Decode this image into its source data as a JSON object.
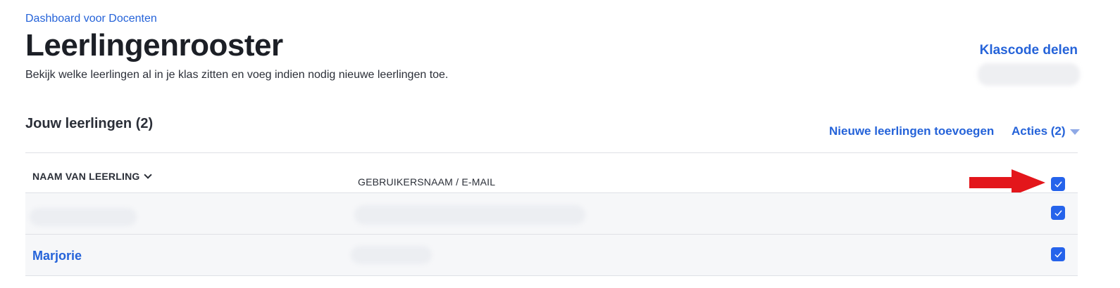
{
  "breadcrumb": "Dashboard voor Docenten",
  "page_title": "Leerlingenrooster",
  "page_subtitle": "Bekijk welke leerlingen al in je klas zitten en voeg indien nodig nieuwe leerlingen toe.",
  "share_class_code_label": "Klascode delen",
  "section_title": "Jouw leerlingen (2)",
  "add_students_label": "Nieuwe leerlingen toevoegen",
  "actions_label": "Acties (2)",
  "table": {
    "columns": {
      "name": "NAAM VAN LEERLING",
      "username": "GEBRUIKERSNAAM / E-MAIL"
    },
    "select_all_checked": true,
    "rows": [
      {
        "name": "",
        "username": "",
        "checked": true
      },
      {
        "name": "Marjorie",
        "username": "",
        "checked": true
      }
    ]
  },
  "colors": {
    "link": "#2563d9",
    "checkbox": "#2563eb",
    "annotation_arrow": "#e3161b"
  },
  "icons": {
    "sort": "chevron-down-icon",
    "actions_caret": "caret-down-icon",
    "checkbox": "checkmark-icon",
    "annotation": "red-arrow-icon"
  }
}
